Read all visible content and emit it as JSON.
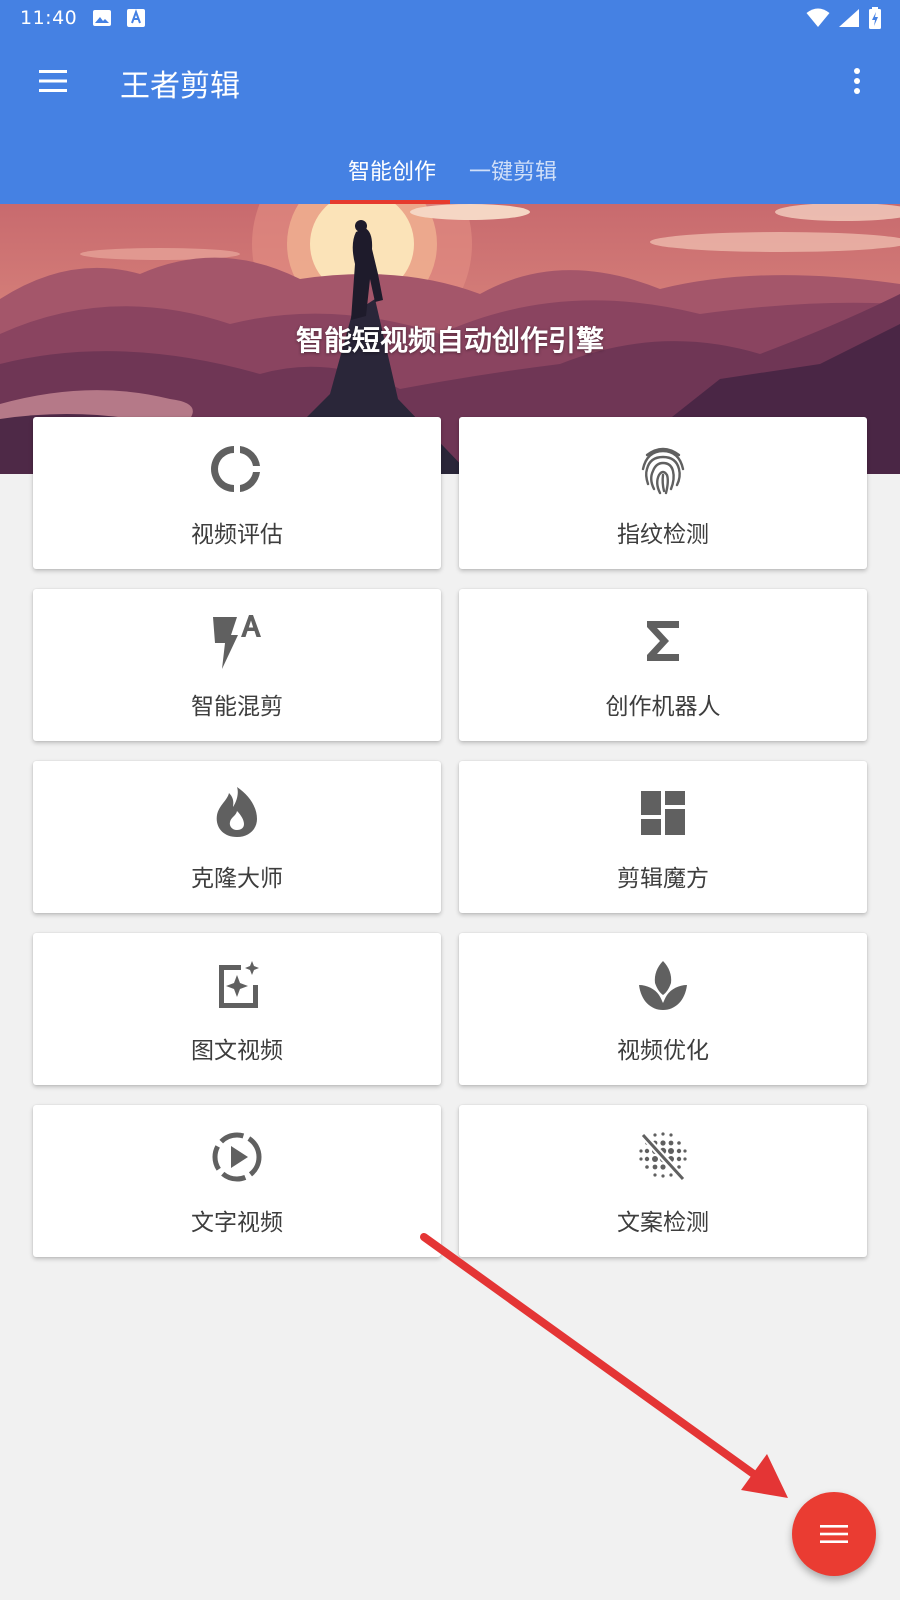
{
  "status_bar": {
    "time": "11:40"
  },
  "app_bar": {
    "title": "王者剪辑"
  },
  "tabs": [
    {
      "label": "智能创作"
    },
    {
      "label": "一键剪辑"
    }
  ],
  "banner": {
    "caption": "智能短视频自动创作引擎"
  },
  "cards": [
    {
      "label": "视频评估",
      "icon": "donut-chart-icon"
    },
    {
      "label": "指纹检测",
      "icon": "fingerprint-icon"
    },
    {
      "label": "智能混剪",
      "icon": "flash-auto-icon"
    },
    {
      "label": "创作机器人",
      "icon": "sigma-icon"
    },
    {
      "label": "克隆大师",
      "icon": "flame-icon"
    },
    {
      "label": "剪辑魔方",
      "icon": "dashboard-grid-icon"
    },
    {
      "label": "图文视频",
      "icon": "image-sparkle-icon"
    },
    {
      "label": "视频优化",
      "icon": "lotus-icon"
    },
    {
      "label": "文字视频",
      "icon": "play-circle-dashed-icon"
    },
    {
      "label": "文案检测",
      "icon": "blur-off-icon"
    }
  ],
  "colors": {
    "primary": "#4581e3",
    "accent": "#ea3c32",
    "icon": "#606060"
  }
}
